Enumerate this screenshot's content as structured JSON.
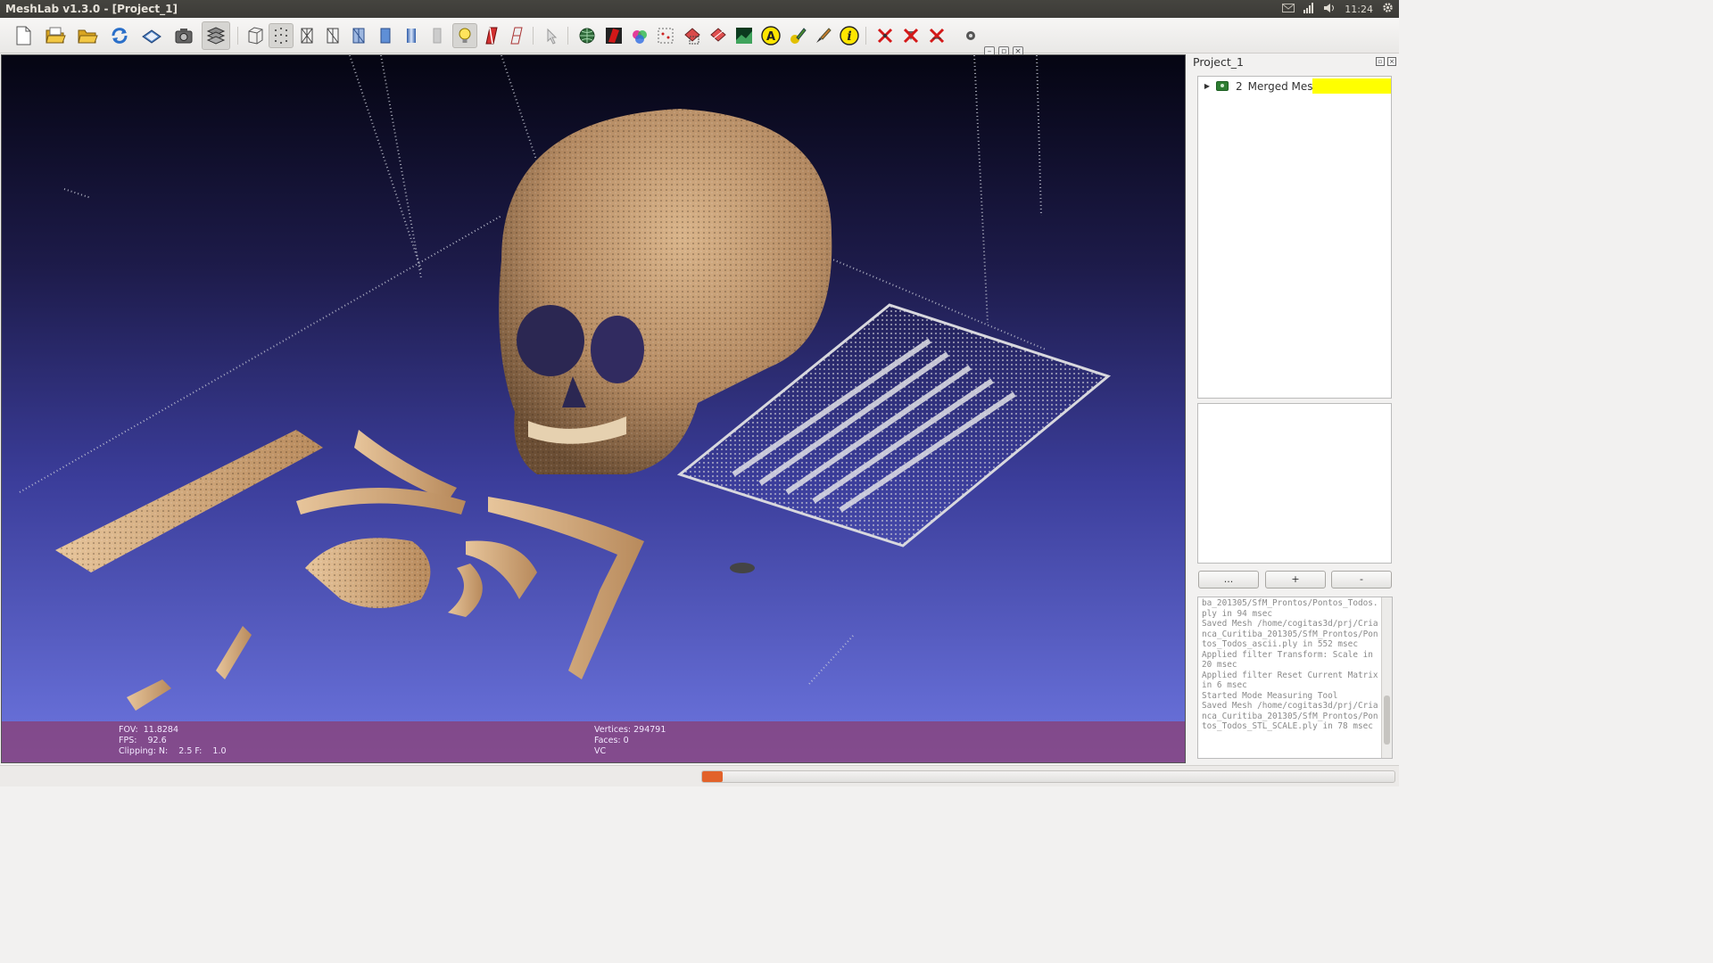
{
  "window": {
    "title": "MeshLab v1.3.0 - [Project_1]"
  },
  "system_tray": {
    "clock": "11:24",
    "icons": [
      "mail-icon",
      "signal-icon",
      "volume-icon",
      "settings-gear-icon"
    ]
  },
  "toolbar": {
    "icons": [
      "new-file-icon",
      "open-project-icon",
      "open-file-icon",
      "reload-icon",
      "save-icon",
      "snapshot-icon",
      "layers-icon",
      "bounding-box-icon",
      "points-icon",
      "wireframe-icon",
      "hidden-lines-icon",
      "flat-lines-icon",
      "flat-icon",
      "smooth-icon",
      "texture-icon",
      "light-icon",
      "double-light-icon",
      "fancy-light-icon",
      "manipulator-icon",
      "globe-icon",
      "red-paint-icon",
      "color-picker-icon",
      "select-vertices-icon",
      "select-faces-icon",
      "select-connected-icon",
      "raster-icon",
      "align-icon",
      "pencil-icon",
      "paint-brush-icon",
      "info-icon",
      "delete-vertices-icon",
      "delete-faces-icon",
      "delete-selection-icon",
      "eye-icon"
    ]
  },
  "viewport": {
    "colors": {
      "bg_top": "#050512",
      "bg_bottom": "#6d76e0",
      "hud_bg": "#8c3c6e"
    },
    "hud": {
      "left": [
        "FOV:  11.8284",
        "FPS:    92.6",
        "Clipping: N:    2.5 F:    1.0"
      ],
      "right": [
        "Vertices: 294791",
        "Faces: 0",
        "VC"
      ]
    }
  },
  "panel": {
    "title": "Project_1",
    "layers": [
      {
        "id": "2",
        "name": "Merged Mesh",
        "color": "#ffff00"
      }
    ],
    "buttons": {
      "more": "...",
      "add": "+",
      "remove": "-"
    },
    "log": "ba_201305/SfM_Prontos/Pontos_Todos.ply in 94 msec\nSaved Mesh /home/cogitas3d/prj/Crianca_Curitiba_201305/SfM_Prontos/Pontos_Todos_ascii.ply in 552 msec\nApplied filter Transform: Scale in 20 msec\nApplied filter Reset Current Matrix in 6 msec\nStarted Mode Measuring Tool\nSaved Mesh /home/cogitas3d/prj/Crianca_Curitiba_201305/SfM_Prontos/Pontos_Todos_STL_SCALE.ply in 78 msec"
  },
  "status": {
    "progress": 0.004
  }
}
